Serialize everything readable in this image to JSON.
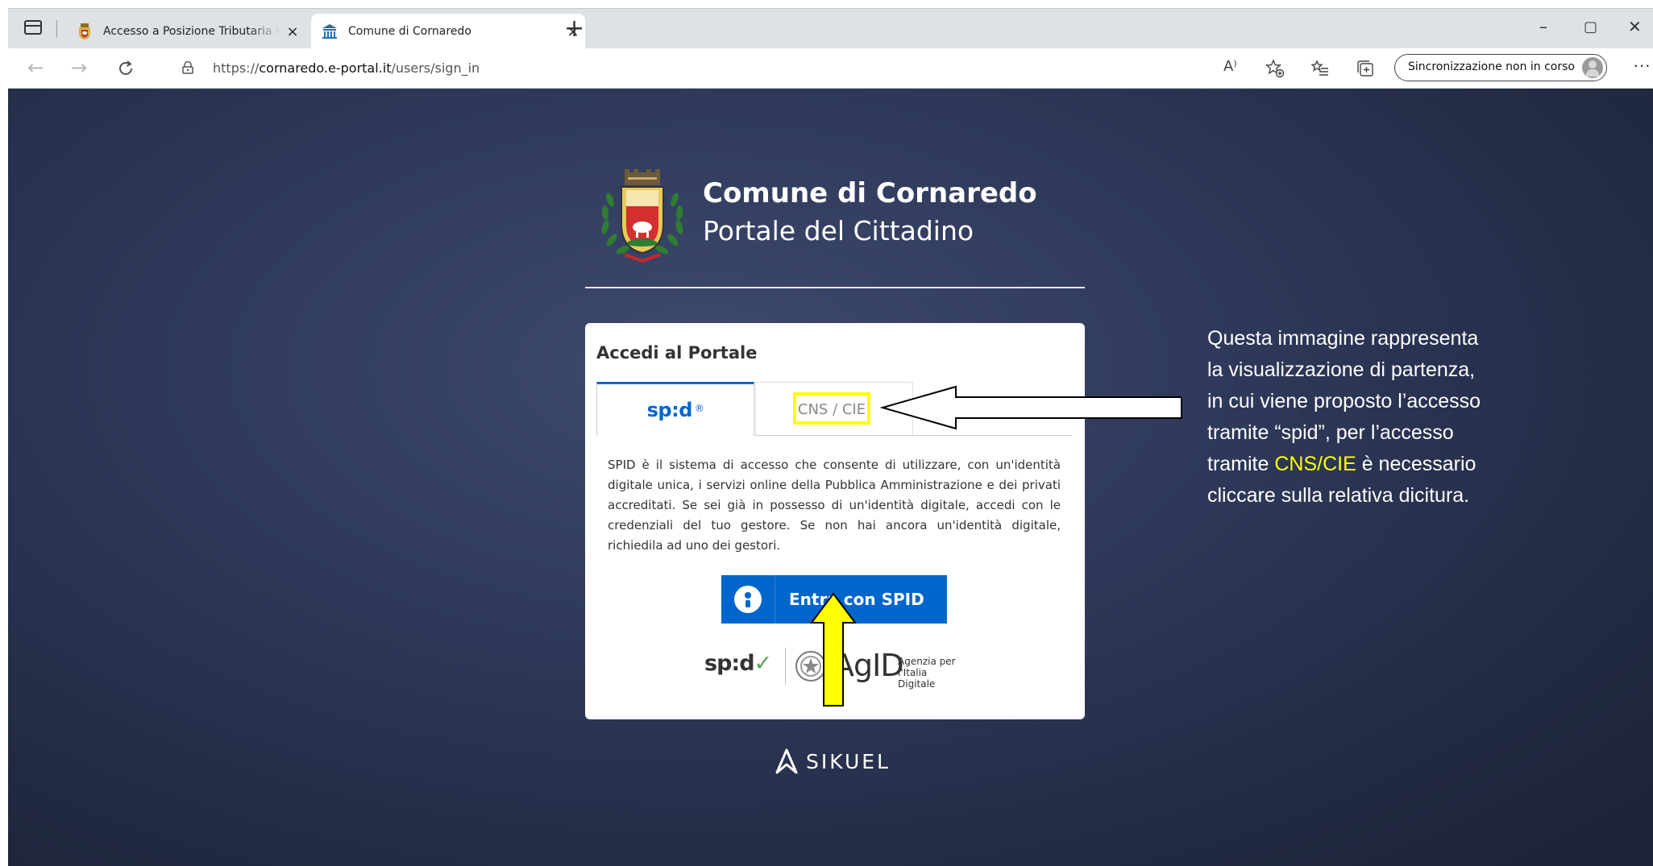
{
  "browser": {
    "tabs": [
      {
        "title": "Accesso a Posizione Tributaria Pe",
        "active": false,
        "favicon": "crest-icon"
      },
      {
        "title": "Comune di Cornaredo",
        "active": true,
        "favicon": "bank-icon"
      }
    ],
    "new_tab_symbol": "+",
    "close_symbol": "×",
    "window_controls": {
      "minimize": "–",
      "maximize": "▢",
      "close": "✕"
    },
    "address": {
      "prefix": "https://",
      "host": "cornaredo.e-portal.it",
      "path": "/users/sign_in"
    },
    "sync_label": "Sincronizzazione non in corso",
    "more_symbol": "···",
    "read_aloud_symbol": "A⁾"
  },
  "brand": {
    "title": "Comune di Cornaredo",
    "subtitle": "Portale del Cittadino"
  },
  "login": {
    "heading": "Accedi al Portale",
    "tabs": [
      {
        "label": "spid",
        "active": true
      },
      {
        "label": "CNS / CIE",
        "active": false
      }
    ],
    "description": "SPID è il sistema di accesso che consente di utilizzare, con un'identità digitale unica, i servizi online della Pubblica Amministrazione e dei privati accreditati. Se sei già in possesso di un'identità digitale, accedi con le credenziali del tuo gestore. Se non hai ancora un'identità digitale, richiedila ad uno dei gestori.",
    "button_label": "Entra con SPID",
    "logos": {
      "spid": "sp:d",
      "agid": "AgID",
      "agid_sub_1": "Agenzia per",
      "agid_sub_2": "l'Italia Digitale"
    }
  },
  "footer": {
    "brand": "SIKUEL"
  },
  "annotation": {
    "line1": "Questa immagine rappresenta",
    "line2": "la visualizzazione di partenza,",
    "line3": "in cui viene proposto l’accesso",
    "line4": "tramite “spid”, per l’accesso",
    "line5_pre": "tramite ",
    "line5_hl": "CNS/CIE",
    "line5_post": " è necessario",
    "line6": "cliccare sulla relativa dicitura."
  },
  "colors": {
    "spid_blue": "#0066cc",
    "highlight_yellow": "#ffff00",
    "page_background": "#2f3a5b"
  }
}
